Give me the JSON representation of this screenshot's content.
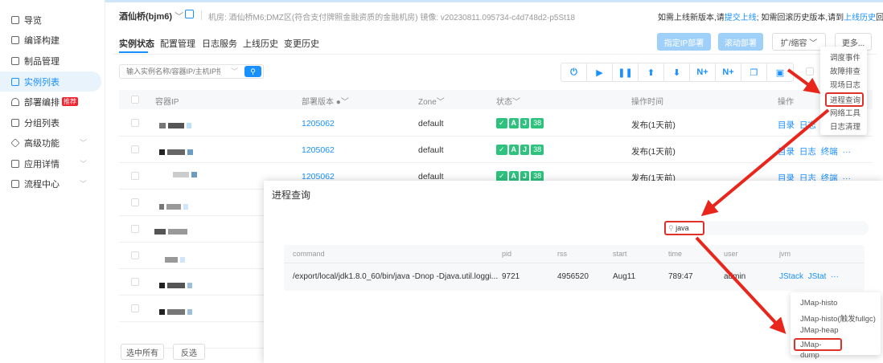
{
  "sidebar": {
    "items": [
      {
        "label": "导览",
        "icon": "home-icon"
      },
      {
        "label": "编译构建",
        "icon": "build-icon"
      },
      {
        "label": "制品管理",
        "icon": "clipboard-icon"
      },
      {
        "label": "实例列表",
        "icon": "grid-icon",
        "active": true
      },
      {
        "label": "部署编排",
        "icon": "bell-icon",
        "badge": "推荐"
      },
      {
        "label": "分组列表",
        "icon": "folder-icon"
      },
      {
        "label": "高级功能",
        "icon": "diamond-icon",
        "expandable": true
      },
      {
        "label": "应用详情",
        "icon": "detail-icon",
        "expandable": true
      },
      {
        "label": "流程中心",
        "icon": "flow-icon",
        "expandable": true
      }
    ]
  },
  "header": {
    "app_name": "酒仙桥(bjm6)",
    "room_label": "机房: 酒仙桥M6;DMZ区(符合支付牌照金融资质的金融机房)",
    "image_label": "镜像: v20230811.095734-c4d748d2-p5St18",
    "notice": {
      "p1": "如需上线新版本,请",
      "link1": "提交上线",
      "p2": "; 如需回滚历史版本,请到",
      "link2": "上线历史",
      "p3": "回滚"
    }
  },
  "tabs": [
    "实例状态",
    "配置管理",
    "日志服务",
    "上线历史",
    "变更历史"
  ],
  "actions": {
    "assign_ip": "指定IP部署",
    "rolling": "滚动部署",
    "scale": "扩/缩容",
    "more": "更多..."
  },
  "more_menu": [
    "调度事件",
    "故障排查",
    "现场日志",
    "进程查询",
    "网络工具",
    "日志清理"
  ],
  "search": {
    "placeholder": "输入实例名称/容器IP/主机IP搜索"
  },
  "toolbar_icons": [
    "power-icon",
    "play-icon",
    "pause-icon",
    "upload-icon",
    "download-icon",
    "n-plus-icon",
    "n-plus-alt-icon",
    "copy-icon",
    "folder-download-icon"
  ],
  "table": {
    "headers": [
      "容器IP",
      "部署版本",
      "Zone",
      "状态",
      "操作时间",
      "操作"
    ],
    "rows": [
      {
        "version": "1205062",
        "zone": "default",
        "status": [
          "✓",
          "A",
          "J",
          "38"
        ],
        "time": "发布(1天前)",
        "ops": [
          "目录",
          "日志",
          "终端",
          "···"
        ]
      },
      {
        "version": "1205062",
        "zone": "default",
        "status": [
          "✓",
          "A",
          "J",
          "38"
        ],
        "time": "发布(1天前)",
        "ops": [
          "目录",
          "日志",
          "终端",
          "···"
        ]
      },
      {
        "version": "1205062",
        "zone": "default",
        "status": [
          "✓",
          "A",
          "J",
          "38"
        ],
        "time": "发布(1天前)",
        "ops": [
          "目录",
          "日志",
          "终端",
          "···"
        ]
      }
    ]
  },
  "footer": {
    "select_all": "选中所有",
    "invert": "反选"
  },
  "modal": {
    "title": "进程查询",
    "search_value": "java",
    "headers": [
      "command",
      "pid",
      "rss",
      "start",
      "time",
      "user",
      "jvm"
    ],
    "row": {
      "command": "/export/local/jdk1.8.0_60/bin/java -Dnop -Djava.util.loggi...",
      "pid": "9721",
      "rss": "4956520",
      "start": "Aug11",
      "time": "789:47",
      "user": "admin",
      "jvm": [
        "JStack",
        "JStat",
        "···"
      ]
    }
  },
  "jvm_menu": [
    "JMap-histo",
    "JMap-histo(触发fullgc)",
    "JMap-heap",
    "JMap-dump"
  ],
  "colors": {
    "accent": "#1890ff",
    "status_green": "#2ec27e",
    "highlight_red": "#e0302a"
  }
}
